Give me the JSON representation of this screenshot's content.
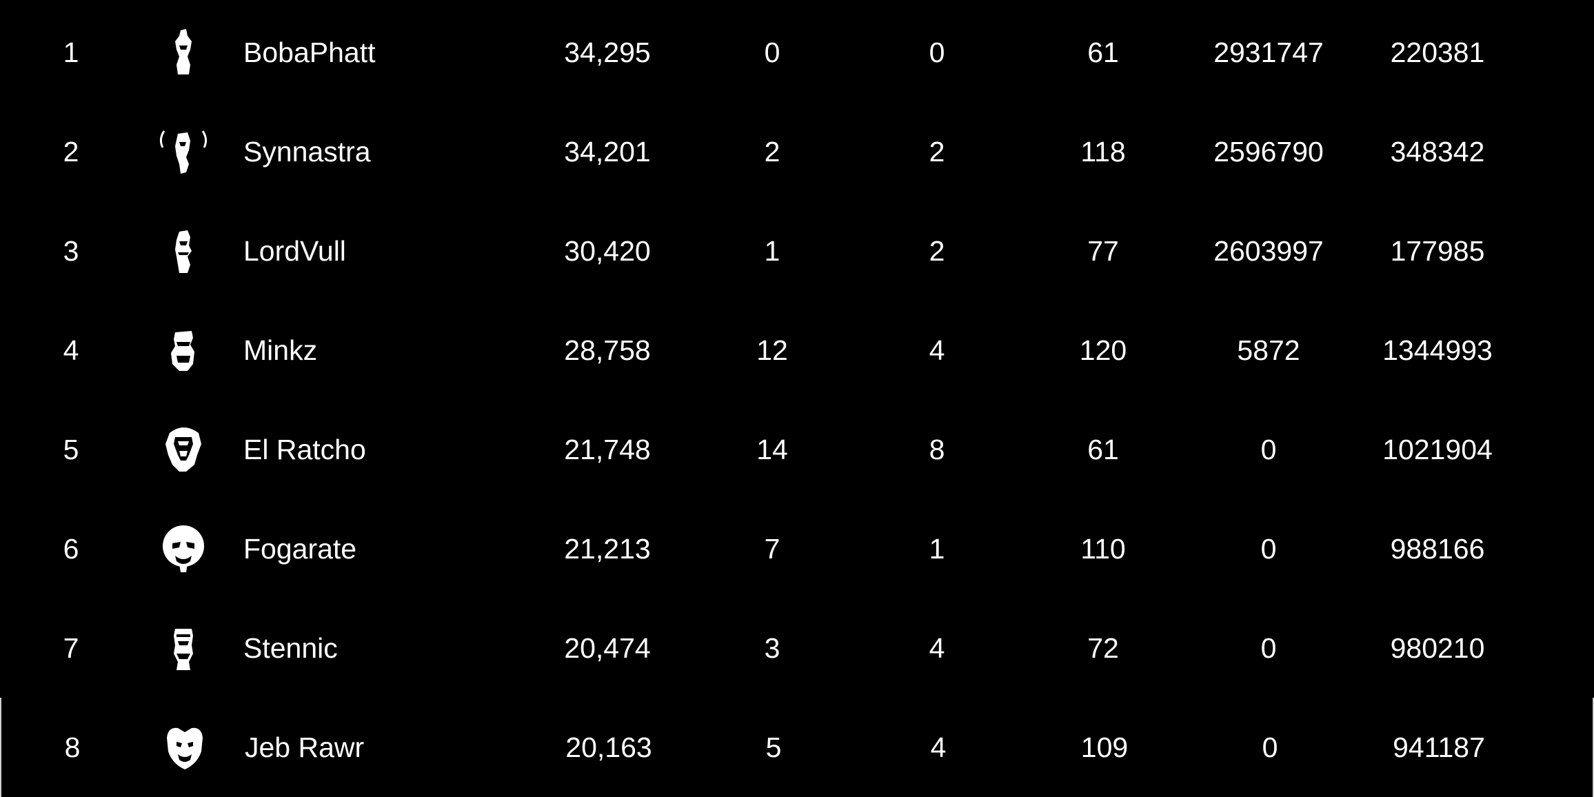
{
  "scoreboard": {
    "rows": [
      {
        "rank": "1",
        "avatar": "bobaphatt-avatar-icon",
        "name": "BobaPhatt",
        "score": "34,295",
        "kills": "0",
        "deaths": "0",
        "assists": "61",
        "damage": "2931747",
        "healing": "220381",
        "highlighted": false
      },
      {
        "rank": "2",
        "avatar": "synnastra-avatar-icon",
        "name": "Synnastra",
        "score": "34,201",
        "kills": "2",
        "deaths": "2",
        "assists": "118",
        "damage": "2596790",
        "healing": "348342",
        "highlighted": false
      },
      {
        "rank": "3",
        "avatar": "lordvull-avatar-icon",
        "name": "LordVull",
        "score": "30,420",
        "kills": "1",
        "deaths": "2",
        "assists": "77",
        "damage": "2603997",
        "healing": "177985",
        "highlighted": false
      },
      {
        "rank": "4",
        "avatar": "minkz-avatar-icon",
        "name": "Minkz",
        "score": "28,758",
        "kills": "12",
        "deaths": "4",
        "assists": "120",
        "damage": "5872",
        "healing": "1344993",
        "highlighted": false
      },
      {
        "rank": "5",
        "avatar": "el-ratcho-avatar-icon",
        "name": "El Ratcho",
        "score": "21,748",
        "kills": "14",
        "deaths": "8",
        "assists": "61",
        "damage": "0",
        "healing": "1021904",
        "highlighted": false
      },
      {
        "rank": "6",
        "avatar": "fogarate-avatar-icon",
        "name": "Fogarate",
        "score": "21,213",
        "kills": "7",
        "deaths": "1",
        "assists": "110",
        "damage": "0",
        "healing": "988166",
        "highlighted": false
      },
      {
        "rank": "7",
        "avatar": "stennic-avatar-icon",
        "name": "Stennic",
        "score": "20,474",
        "kills": "3",
        "deaths": "4",
        "assists": "72",
        "damage": "0",
        "healing": "980210",
        "highlighted": false
      },
      {
        "rank": "8",
        "avatar": "jeb-rawr-avatar-icon",
        "name": "Jeb Rawr",
        "score": "20,163",
        "kills": "5",
        "deaths": "4",
        "assists": "109",
        "damage": "0",
        "healing": "941187",
        "highlighted": true
      }
    ]
  },
  "colors": {
    "background": "#000000",
    "text": "#ffffff",
    "highlight_border": "#d0d0d0"
  }
}
